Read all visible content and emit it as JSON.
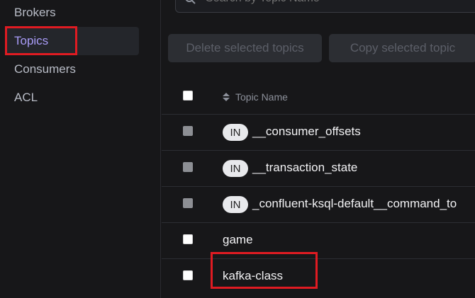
{
  "sidebar": {
    "items": [
      {
        "label": "Brokers"
      },
      {
        "label": "Topics"
      },
      {
        "label": "Consumers"
      },
      {
        "label": "ACL"
      }
    ]
  },
  "search": {
    "placeholder": "Search by Topic Name"
  },
  "toolbar": {
    "delete_label": "Delete selected topics",
    "copy_label": "Copy selected topic"
  },
  "table": {
    "header": {
      "topic_name": "Topic Name"
    },
    "rows": [
      {
        "badge": "IN",
        "name": "__consumer_offsets",
        "internal": true
      },
      {
        "badge": "IN",
        "name": "__transaction_state",
        "internal": true
      },
      {
        "badge": "IN",
        "name": "_confluent-ksql-default__command_to",
        "internal": true
      },
      {
        "badge": "",
        "name": "game",
        "internal": false
      },
      {
        "badge": "",
        "name": "kafka-class",
        "internal": false
      }
    ]
  },
  "colors": {
    "background": "#171719",
    "active_nav": "#a99cf8",
    "highlight": "#e01b22"
  }
}
